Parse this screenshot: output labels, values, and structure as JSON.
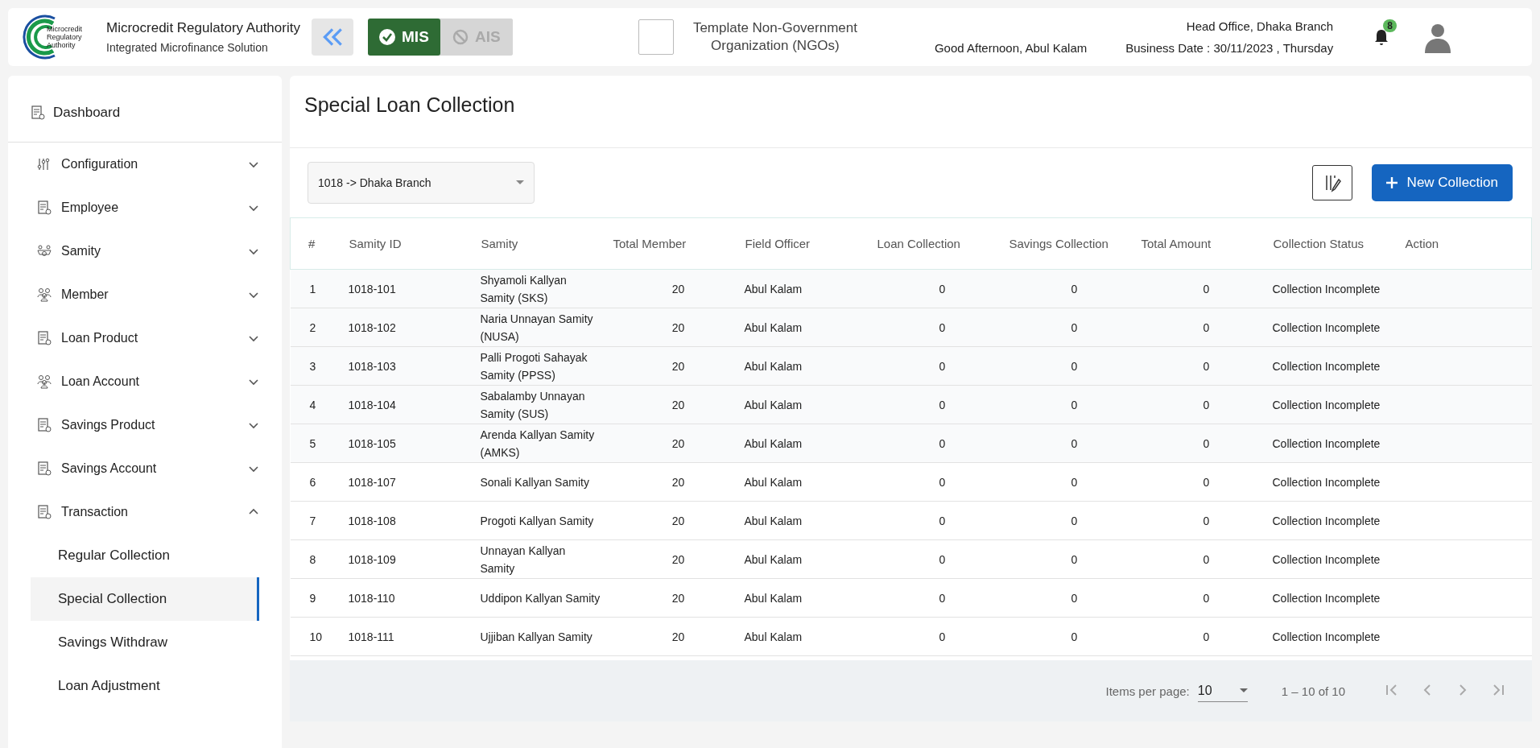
{
  "header": {
    "org_name": "Microcredit Regulatory Authority",
    "org_subtitle": "Integrated Microfinance Solution",
    "logo_text": [
      "Microcredit",
      "Regulatory",
      "Authority"
    ],
    "modules": [
      {
        "label": "MIS",
        "selected": true
      },
      {
        "label": "AIS",
        "selected": false
      }
    ],
    "ngo_name": "Template Non-Government Organization (NGOs)",
    "greeting": "Good Afternoon, Abul Kalam",
    "branch": "Head Office, Dhaka Branch",
    "business_date": "Business Date : 30/11/2023 , Thursday",
    "notification_count": "8"
  },
  "sidebar": {
    "dashboard": "Dashboard",
    "items": [
      {
        "label": "Configuration",
        "expanded": false
      },
      {
        "label": "Employee",
        "expanded": false
      },
      {
        "label": "Samity",
        "expanded": false
      },
      {
        "label": "Member",
        "expanded": false
      },
      {
        "label": "Loan Product",
        "expanded": false
      },
      {
        "label": "Loan Account",
        "expanded": false
      },
      {
        "label": "Savings Product",
        "expanded": false
      },
      {
        "label": "Savings Account",
        "expanded": false
      },
      {
        "label": "Transaction",
        "expanded": true,
        "children": [
          {
            "label": "Regular Collection",
            "selected": false
          },
          {
            "label": "Special Collection",
            "selected": true
          },
          {
            "label": "Savings Withdraw",
            "selected": false
          },
          {
            "label": "Loan Adjustment",
            "selected": false
          }
        ]
      }
    ]
  },
  "page": {
    "title": "Special Loan Collection",
    "branch_select": "1018 -> Dhaka Branch",
    "new_button": "New Collection"
  },
  "table": {
    "columns": [
      "#",
      "Samity ID",
      "Samity",
      "Total Member",
      "Field Officer",
      "Loan Collection",
      "Savings Collection",
      "Total Amount",
      "Collection Status",
      "Action"
    ],
    "rows": [
      [
        "1",
        "1018-101",
        "Shyamoli Kallyan Samity (SKS)",
        "20",
        "Abul Kalam",
        "0",
        "0",
        "0",
        "Collection Incomplete"
      ],
      [
        "2",
        "1018-102",
        "Naria Unnayan Samity (NUSA)",
        "20",
        "Abul Kalam",
        "0",
        "0",
        "0",
        "Collection Incomplete"
      ],
      [
        "3",
        "1018-103",
        "Palli Progoti Sahayak Samity (PPSS)",
        "20",
        "Abul Kalam",
        "0",
        "0",
        "0",
        "Collection Incomplete"
      ],
      [
        "4",
        "1018-104",
        "Sabalamby Unnayan Samity (SUS)",
        "20",
        "Abul Kalam",
        "0",
        "0",
        "0",
        "Collection Incomplete"
      ],
      [
        "5",
        "1018-105",
        "Arenda Kallyan Samity (AMKS)",
        "20",
        "Abul Kalam",
        "0",
        "0",
        "0",
        "Collection Incomplete"
      ],
      [
        "6",
        "1018-107",
        "Sonali Kallyan Samity",
        "20",
        "Abul Kalam",
        "0",
        "0",
        "0",
        "Collection Incomplete"
      ],
      [
        "7",
        "1018-108",
        "Progoti Kallyan Samity",
        "20",
        "Abul Kalam",
        "0",
        "0",
        "0",
        "Collection Incomplete"
      ],
      [
        "8",
        "1018-109",
        "Unnayan Kallyan Samity",
        "20",
        "Abul Kalam",
        "0",
        "0",
        "0",
        "Collection Incomplete"
      ],
      [
        "9",
        "1018-110",
        "Uddipon Kallyan Samity",
        "20",
        "Abul Kalam",
        "0",
        "0",
        "0",
        "Collection Incomplete"
      ],
      [
        "10",
        "1018-111",
        "Ujjiban Kallyan Samity",
        "20",
        "Abul Kalam",
        "0",
        "0",
        "0",
        "Collection Incomplete"
      ]
    ]
  },
  "paginator": {
    "label": "Items per page:",
    "page_size": "10",
    "range": "1 – 10 of 10"
  }
}
